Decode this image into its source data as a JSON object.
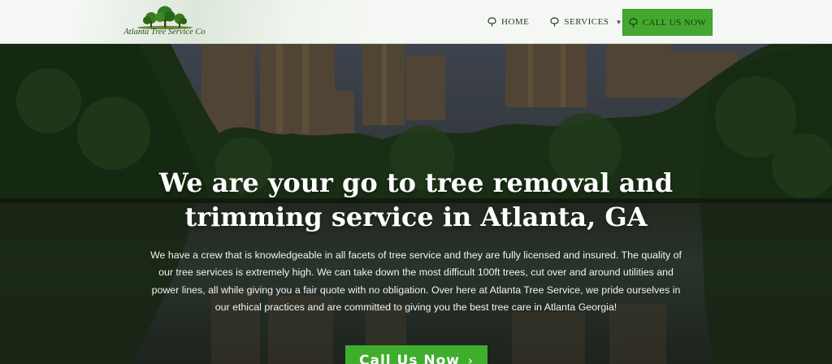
{
  "brand": {
    "name": "Atlanta Tree Service Co",
    "colors": {
      "accent": "#43a82f",
      "header_bg": "#f4f7f3",
      "nav_text": "#2e3a2c"
    }
  },
  "nav": {
    "items": [
      {
        "label": "HOME",
        "icon": "tree-icon"
      },
      {
        "label": "SERVICES",
        "icon": "tree-icon",
        "dropdown": true
      }
    ],
    "cta": {
      "label": "CALL US NOW",
      "icon": "tree-icon"
    }
  },
  "hero": {
    "title_line1": "We are your go to tree removal and",
    "title_line2": "trimming service in Atlanta, GA",
    "description": "We have a crew that is knowledgeable in all facets of tree service and they are fully licensed and insured. The quality of our tree services is extremely high. We can take down the most difficult 100ft trees, cut over and around utilities and power lines, all while giving you a fair quote with no obligation. Over here at Atlanta Tree Service, we pride ourselves in our ethical practices and are committed to giving you the best tree care in Atlanta Georgia!",
    "cta_label": "Call Us Now",
    "cta_icon": "chevron-right-icon"
  }
}
